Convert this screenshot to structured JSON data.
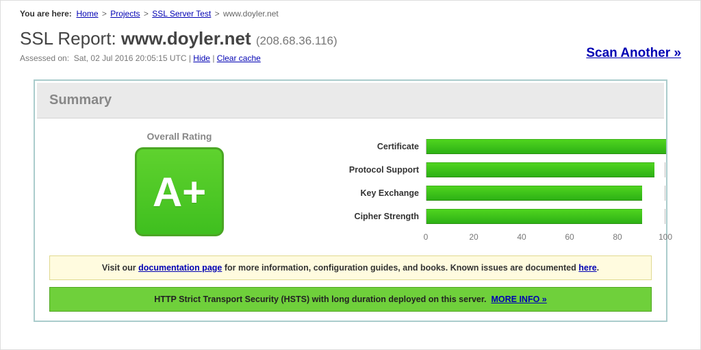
{
  "breadcrumb": {
    "label": "You are here:",
    "items": [
      "Home",
      "Projects",
      "SSL Server Test"
    ],
    "current": "www.doyler.net"
  },
  "report": {
    "prefix": "SSL Report: ",
    "host": "www.doyler.net",
    "ip": "(208.68.36.116)"
  },
  "meta": {
    "assessed_label": "Assessed on:",
    "assessed_value": "Sat, 02 Jul 2016 20:05:15 UTC",
    "hide": "Hide",
    "clear": "Clear cache"
  },
  "scan_another": "Scan Another »",
  "summary": {
    "heading": "Summary",
    "overall_label": "Overall Rating",
    "grade": "A+"
  },
  "chart_data": {
    "type": "bar",
    "categories": [
      "Certificate",
      "Protocol Support",
      "Key Exchange",
      "Cipher Strength"
    ],
    "values": [
      100,
      95,
      90,
      90
    ],
    "ticks": [
      0,
      20,
      40,
      60,
      80,
      100
    ],
    "xlim": [
      0,
      100
    ]
  },
  "hints": {
    "doc_pre": "Visit our ",
    "doc_link": "documentation page",
    "doc_post": " for more information, configuration guides, and books. Known issues are documented ",
    "doc_here": "here",
    "hsts_text": "HTTP Strict Transport Security (HSTS) with long duration deployed on this server.",
    "hsts_more": "MORE INFO »"
  }
}
